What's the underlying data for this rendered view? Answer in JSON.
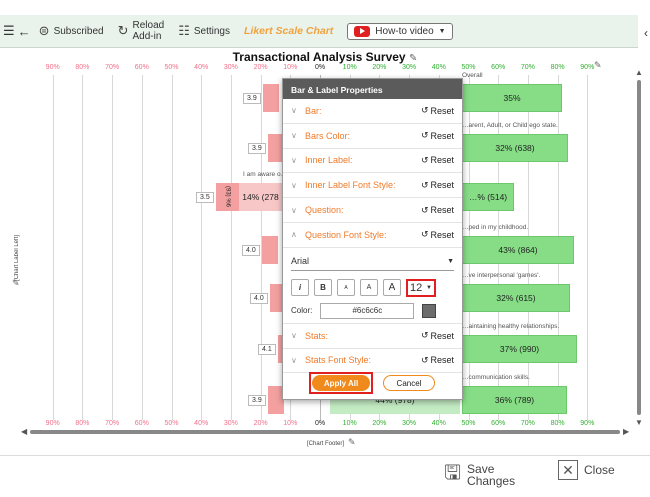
{
  "toolbar": {
    "subscribed": "Subscribed",
    "reload": "Reload\nAdd-in",
    "settings": "Settings",
    "app_title": "Likert Scale Chart",
    "howto": "How-to video"
  },
  "chart": {
    "title": "Transactional Analysis Survey",
    "axis_ticks_neg": [
      "90%",
      "80%",
      "70%",
      "60%",
      "50%",
      "40%",
      "30%",
      "20%",
      "10%"
    ],
    "axis_zero": "0%",
    "axis_ticks_pos": [
      "10%",
      "20%",
      "30%",
      "40%",
      "50%",
      "60%",
      "70%",
      "80%",
      "90%"
    ],
    "y_label": "[Chart Label Left]",
    "footer": "[Chart Footer]",
    "rows": [
      {
        "mean": "3.9",
        "text": "Overall",
        "right_bar": "35%"
      },
      {
        "mean": "3.9",
        "text": "…arent, Adult, or Child ego state.",
        "right_bar": "32% (638)"
      },
      {
        "mean": "3.5",
        "text": "I am aware o…",
        "left_bar": "14% (278",
        "left_v": "(93) %6",
        "right_bar": "…% (514)",
        "right_text": "…rsations."
      },
      {
        "mean": "4.0",
        "text": "…ped in my childhood.",
        "right_bar": "43% (864)"
      },
      {
        "mean": "4.0",
        "text": "…ve interpersonal 'games'.",
        "right_bar": "32% (615)"
      },
      {
        "mean": "4.1",
        "text": "…aintaining healthy relationships.",
        "right_bar": "37% (990)"
      },
      {
        "mean": "3.9",
        "text": "…communication skills.",
        "mid_bar": "44% (978)",
        "right_bar": "36% (789)"
      }
    ]
  },
  "panel": {
    "header": "Bar & Label Properties",
    "reset_label": "Reset",
    "sections_top": [
      "Bar:",
      "Bars Color:",
      "Inner Label:",
      "Inner Label Font Style:",
      "Question:",
      "Question Font Style:"
    ],
    "font_value": "Arial",
    "format_buttons": [
      "i",
      "B",
      "A",
      "A",
      "A"
    ],
    "font_size": "12",
    "color_label": "Color:",
    "color_value": "#6c6c6c",
    "sections_bottom": [
      "Stats:",
      "Stats Font Style:"
    ],
    "apply_label": "Apply All",
    "cancel_label": "Cancel"
  },
  "bottom": {
    "save": "Save\nChanges",
    "close": "Close"
  }
}
